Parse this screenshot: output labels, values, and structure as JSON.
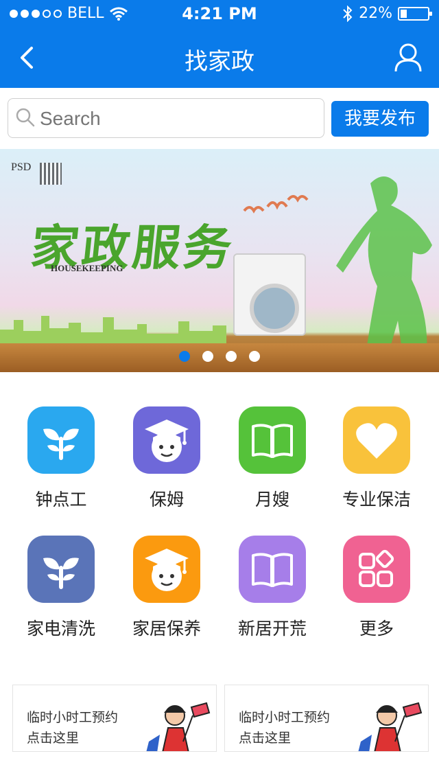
{
  "status": {
    "carrier": "BELL",
    "time": "4:21 PM",
    "battery": "22%",
    "battery_level": 0.22
  },
  "nav": {
    "title": "找家政"
  },
  "search": {
    "placeholder": "Search",
    "publish_label": "我要发布"
  },
  "banner": {
    "title": "家政服务",
    "subtitle": "HOUSEKEEPING",
    "logo_text": "PSD",
    "active_slide": 1,
    "slides": 4
  },
  "services": [
    {
      "label": "钟点工",
      "icon": "sprout-icon",
      "color": "#2aa8ef"
    },
    {
      "label": "保姆",
      "icon": "graduate-face-icon",
      "color": "#6e68d9"
    },
    {
      "label": "月嫂",
      "icon": "open-book-icon",
      "color": "#55c23a"
    },
    {
      "label": "专业保洁",
      "icon": "heart-icon",
      "color": "#f9c23b"
    },
    {
      "label": "家电清洗",
      "icon": "sprout-icon",
      "color": "#5a74b8"
    },
    {
      "label": "家居保养",
      "icon": "graduate-face-icon",
      "color": "#fb9a0f"
    },
    {
      "label": "新居开荒",
      "icon": "open-book-icon",
      "color": "#a67ee9"
    },
    {
      "label": "更多",
      "icon": "more-grid-icon",
      "color": "#f06292"
    }
  ],
  "ads": [
    {
      "line1": "临时小时工预约",
      "line2": "点击这里"
    },
    {
      "line1": "临时小时工预约",
      "line2": "点击这里"
    }
  ]
}
